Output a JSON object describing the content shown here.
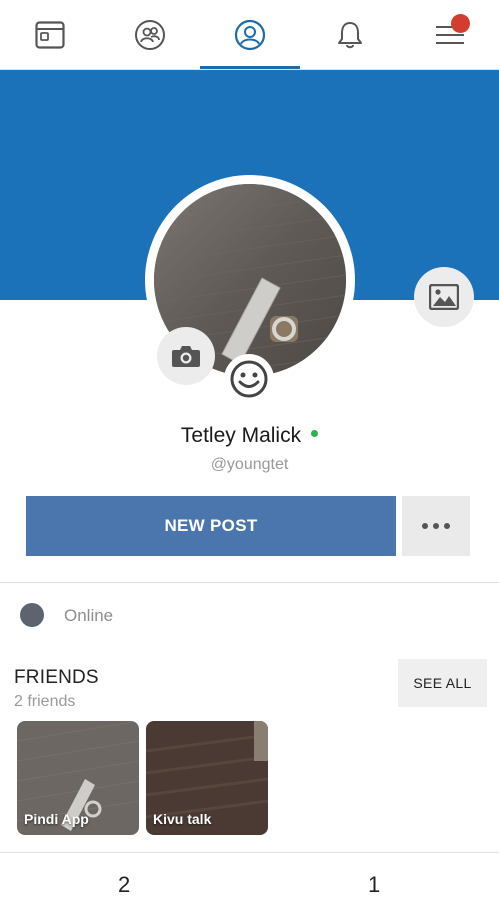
{
  "nav": {
    "items": [
      {
        "icon": "feed-icon"
      },
      {
        "icon": "friends-icon"
      },
      {
        "icon": "profile-icon",
        "active": true
      },
      {
        "icon": "bell-icon"
      },
      {
        "icon": "menu-icon",
        "badge": true
      }
    ]
  },
  "colors": {
    "cover": "#1b72b9",
    "accent": "#1b6ca8",
    "new_post_button": "#4a76ad",
    "online": "#2bb24c",
    "badge": "#d33c2e"
  },
  "profile": {
    "name": "Tetley Malick",
    "username": "@youngtet",
    "online": true
  },
  "actions": {
    "new_post_label": "NEW POST"
  },
  "status": {
    "text": "Online"
  },
  "friends": {
    "title": "FRIENDS",
    "count_label": "2 friends",
    "see_all_label": "SEE ALL",
    "items": [
      {
        "name": "Pindi App"
      },
      {
        "name": "Kivu talk"
      }
    ]
  },
  "counters": {
    "left": "2",
    "right": "1"
  }
}
